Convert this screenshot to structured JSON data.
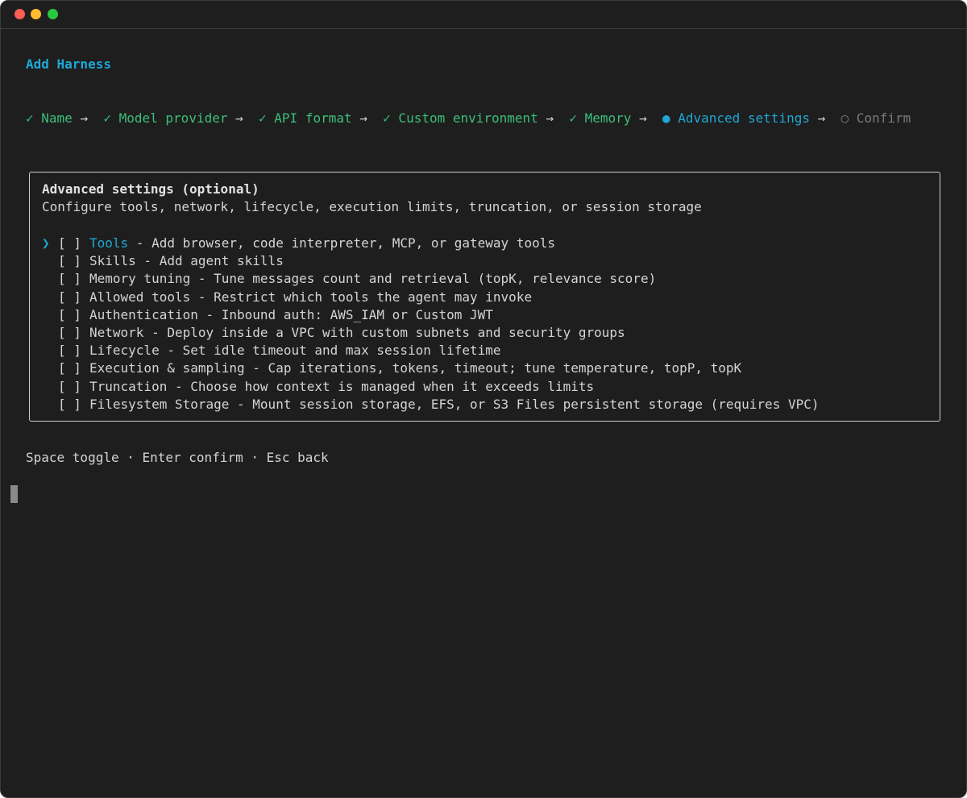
{
  "window": {
    "traffic_lights": [
      "close",
      "minimize",
      "zoom"
    ]
  },
  "heading": "Add Harness",
  "steps": [
    {
      "icon": "✓",
      "label": "Name",
      "state": "done"
    },
    {
      "icon": "✓",
      "label": "Model provider",
      "state": "done"
    },
    {
      "icon": "✓",
      "label": "API format",
      "state": "done"
    },
    {
      "icon": "✓",
      "label": "Custom environment",
      "state": "done"
    },
    {
      "icon": "✓",
      "label": "Memory",
      "state": "done"
    },
    {
      "icon": "●",
      "label": "Advanced settings",
      "state": "active"
    },
    {
      "icon": "○",
      "label": "Confirm",
      "state": "pending"
    }
  ],
  "step_separator": "→",
  "panel": {
    "title": "Advanced settings (optional)",
    "description": "Configure tools, network, lifecycle, execution limits, truncation, or session storage",
    "cursor_glyph": "❯",
    "checkbox_glyph": "[ ]",
    "options": [
      {
        "label": "Tools",
        "description": "Add browser, code interpreter, MCP, or gateway tools",
        "checked": false,
        "selected": true
      },
      {
        "label": "Skills",
        "description": "Add agent skills",
        "checked": false,
        "selected": false
      },
      {
        "label": "Memory tuning",
        "description": "Tune messages count and retrieval (topK, relevance score)",
        "checked": false,
        "selected": false
      },
      {
        "label": "Allowed tools",
        "description": "Restrict which tools the agent may invoke",
        "checked": false,
        "selected": false
      },
      {
        "label": "Authentication",
        "description": "Inbound auth: AWS_IAM or Custom JWT",
        "checked": false,
        "selected": false
      },
      {
        "label": "Network",
        "description": "Deploy inside a VPC with custom subnets and security groups",
        "checked": false,
        "selected": false
      },
      {
        "label": "Lifecycle",
        "description": "Set idle timeout and max session lifetime",
        "checked": false,
        "selected": false
      },
      {
        "label": "Execution & sampling",
        "description": "Cap iterations, tokens, timeout; tune temperature, topP, topK",
        "checked": false,
        "selected": false
      },
      {
        "label": "Truncation",
        "description": "Choose how context is managed when it exceeds limits",
        "checked": false,
        "selected": false
      },
      {
        "label": "Filesystem Storage",
        "description": "Mount session storage, EFS, or S3 Files persistent storage (requires VPC)",
        "checked": false,
        "selected": false
      }
    ]
  },
  "hint": "Space toggle · Enter confirm · Esc back",
  "colors": {
    "background": "#1e1e1e",
    "accent": "#1fa8d6",
    "done": "#3bbf7a",
    "pending": "#7a7a7a",
    "text": "#d4d4d4"
  }
}
